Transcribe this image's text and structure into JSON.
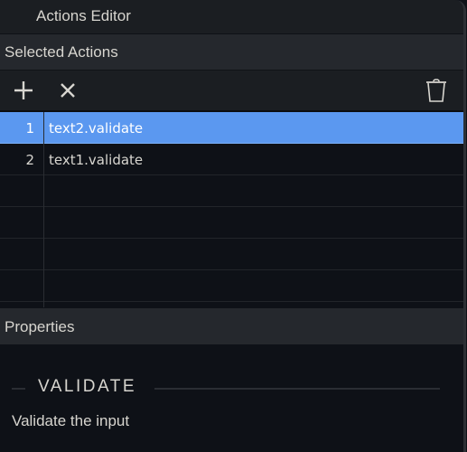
{
  "window": {
    "title": "Actions Editor"
  },
  "selected_actions": {
    "header": "Selected Actions",
    "toolbar": {
      "add": {
        "icon": "plus-icon",
        "glyph": "+"
      },
      "remove": {
        "icon": "close-icon",
        "glyph": "×"
      },
      "delete": {
        "icon": "trash-icon"
      }
    },
    "rows": [
      {
        "index": "1",
        "name": "text2.validate",
        "selected": true
      },
      {
        "index": "2",
        "name": "text1.validate",
        "selected": false
      },
      {
        "index": "",
        "name": "",
        "selected": false
      },
      {
        "index": "",
        "name": "",
        "selected": false
      },
      {
        "index": "",
        "name": "",
        "selected": false
      },
      {
        "index": "",
        "name": "",
        "selected": false
      }
    ]
  },
  "properties": {
    "header": "Properties",
    "heading": "VALIDATE",
    "description": "Validate the input"
  },
  "colors": {
    "selection": "#5b98f0",
    "header_bg": "#25282d",
    "panel_bg": "#0e1117"
  }
}
